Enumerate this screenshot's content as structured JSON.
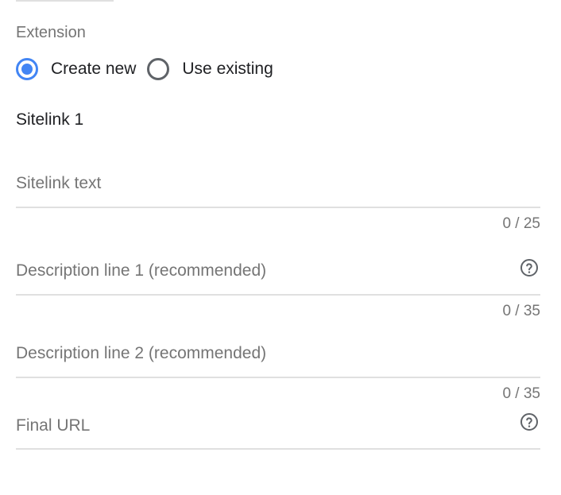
{
  "section_label": "Extension",
  "radio_options": [
    {
      "label": "Create new",
      "checked": true
    },
    {
      "label": "Use existing",
      "checked": false
    }
  ],
  "sitelink_title": "Sitelink 1",
  "fields": {
    "sitelink_text": {
      "placeholder": "Sitelink text",
      "counter": "0 / 25"
    },
    "description_1": {
      "placeholder": "Description line 1 (recommended)",
      "counter": "0 / 35",
      "help_icon": "help-circle-icon"
    },
    "description_2": {
      "placeholder": "Description line 2 (recommended)",
      "counter": "0 / 35"
    },
    "final_url": {
      "placeholder": "Final URL",
      "help_icon": "help-circle-icon"
    }
  },
  "colors": {
    "accent": "#4285f4",
    "muted_text": "#757575",
    "divider": "#e0e0e0"
  }
}
